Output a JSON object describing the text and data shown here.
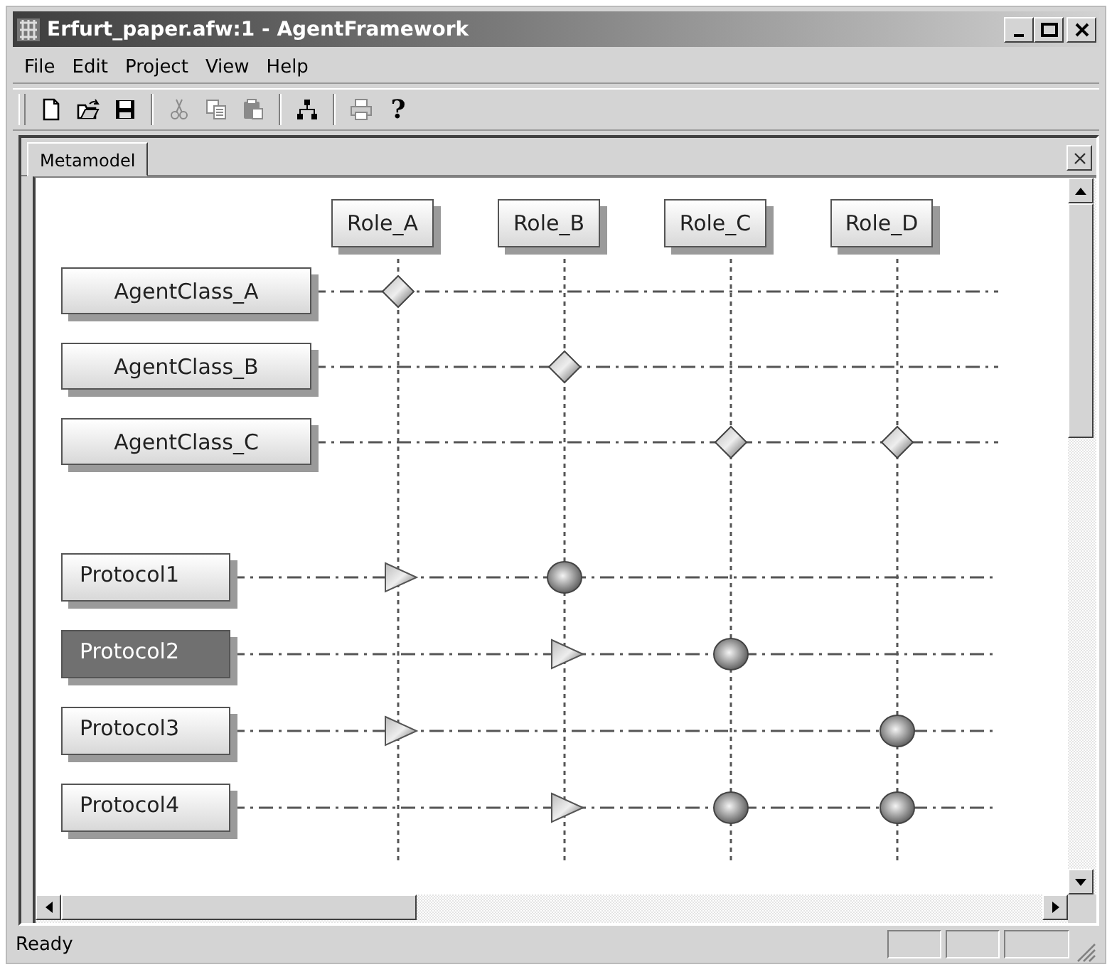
{
  "window": {
    "title": "Erfurt_paper.afw:1 - AgentFramework"
  },
  "menu": [
    {
      "label": "File"
    },
    {
      "label": "Edit"
    },
    {
      "label": "Project"
    },
    {
      "label": "View"
    },
    {
      "label": "Help"
    }
  ],
  "toolbar": [
    {
      "kind": "new",
      "disabled": false
    },
    {
      "kind": "open",
      "disabled": false
    },
    {
      "kind": "save",
      "disabled": false
    },
    {
      "kind": "separator"
    },
    {
      "kind": "cut",
      "disabled": true
    },
    {
      "kind": "copy",
      "disabled": true
    },
    {
      "kind": "paste",
      "disabled": true
    },
    {
      "kind": "separator"
    },
    {
      "kind": "diagram",
      "disabled": false
    },
    {
      "kind": "separator"
    },
    {
      "kind": "print",
      "disabled": true
    },
    {
      "kind": "help",
      "label": "?",
      "disabled": false
    }
  ],
  "tabs": [
    {
      "label": "Metamodel",
      "selected": true
    }
  ],
  "diagram": {
    "roles": [
      "Role_A",
      "Role_B",
      "Role_C",
      "Role_D"
    ],
    "agent_classes": [
      {
        "label": "AgentClass_A",
        "selected": false,
        "links": [
          {
            "kind": "diamond"
          },
          {
            "kind": "none"
          },
          {
            "kind": "none"
          },
          {
            "kind": "none"
          }
        ]
      },
      {
        "label": "AgentClass_B",
        "selected": false,
        "links": [
          {
            "kind": "none"
          },
          {
            "kind": "diamond"
          },
          {
            "kind": "none"
          },
          {
            "kind": "none"
          }
        ]
      },
      {
        "label": "AgentClass_C",
        "selected": false,
        "links": [
          {
            "kind": "none"
          },
          {
            "kind": "none"
          },
          {
            "kind": "diamond"
          },
          {
            "kind": "diamond"
          }
        ]
      }
    ],
    "protocols": [
      {
        "label": "Protocol1",
        "selected": false,
        "links": [
          {
            "kind": "triangle"
          },
          {
            "kind": "circle"
          },
          {
            "kind": "none"
          },
          {
            "kind": "none"
          }
        ]
      },
      {
        "label": "Protocol2",
        "selected": true,
        "links": [
          {
            "kind": "none"
          },
          {
            "kind": "triangle"
          },
          {
            "kind": "circle"
          },
          {
            "kind": "none"
          }
        ]
      },
      {
        "label": "Protocol3",
        "selected": false,
        "links": [
          {
            "kind": "triangle"
          },
          {
            "kind": "none"
          },
          {
            "kind": "none"
          },
          {
            "kind": "circle"
          }
        ]
      },
      {
        "label": "Protocol4",
        "selected": false,
        "links": [
          {
            "kind": "none"
          },
          {
            "kind": "triangle"
          },
          {
            "kind": "circle"
          },
          {
            "kind": "circle"
          }
        ]
      }
    ]
  },
  "status_bar": {
    "text": "Ready"
  }
}
